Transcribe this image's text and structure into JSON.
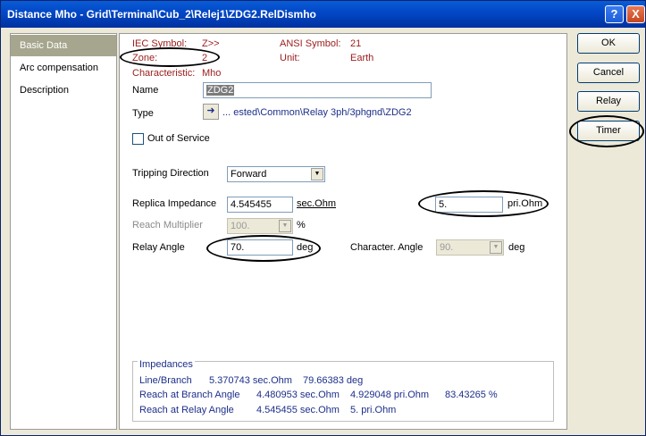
{
  "window": {
    "title": "Distance Mho - Grid\\Terminal\\Cub_2\\Relej1\\ZDG2.RelDismho",
    "help_btn": "?",
    "close_btn": "X"
  },
  "sidebar": {
    "items": [
      {
        "label": "Basic Data",
        "active": true
      },
      {
        "label": "Arc compensation",
        "active": false
      },
      {
        "label": "Description",
        "active": false
      }
    ]
  },
  "buttons": {
    "ok": "OK",
    "cancel": "Cancel",
    "relay": "Relay",
    "timer": "Timer"
  },
  "info": {
    "iec_symbol_label": "IEC Symbol:",
    "iec_symbol_value": "Z>>",
    "ansi_symbol_label": "ANSI Symbol:",
    "ansi_symbol_value": "21",
    "zone_label": "Zone:",
    "zone_value": "2",
    "unit_label": "Unit:",
    "unit_value": "Earth",
    "characteristic_label": "Characteristic:",
    "characteristic_value": "Mho"
  },
  "form": {
    "name_label": "Name",
    "name_value": "ZDG2",
    "type_label": "Type",
    "type_arrow": "➜",
    "type_value": "... ested\\Common\\Relay 3ph/3phgnd\\ZDG2",
    "out_of_service_label": "Out of Service",
    "out_of_service_checked": false,
    "tripping_direction_label": "Tripping Direction",
    "tripping_direction_value": "Forward",
    "replica_impedance_label": "Replica Impedance",
    "replica_impedance_value": "4.545455",
    "replica_impedance_unit": "sec.Ohm",
    "replica_impedance_pri_value": "5.",
    "replica_impedance_pri_unit": "pri.Ohm",
    "reach_multiplier_label": "Reach Multiplier",
    "reach_multiplier_value": "100.",
    "reach_multiplier_unit": "%",
    "relay_angle_label": "Relay Angle",
    "relay_angle_value": "70.",
    "relay_angle_unit": "deg",
    "character_angle_label": "Character. Angle",
    "character_angle_value": "90.",
    "character_angle_unit": "deg"
  },
  "impedances": {
    "title": "Impedances",
    "rows": [
      {
        "label": "Line/Branch",
        "v1": "5.370743 sec.Ohm",
        "v2": "79.66383 deg",
        "v3": ""
      },
      {
        "label": "Reach at Branch Angle",
        "v1": "4.480953 sec.Ohm",
        "v2": "4.929048 pri.Ohm",
        "v3": "83.43265 %"
      },
      {
        "label": "Reach at Relay Angle",
        "v1": "4.545455 sec.Ohm",
        "v2": "5. pri.Ohm",
        "v3": ""
      }
    ]
  },
  "icons": {
    "dropdown": "▼"
  },
  "colors": {
    "title_bar": "#0247c5",
    "info_red": "#9b1b1b",
    "info_blue": "#1c2f8a",
    "sidebar_active": "#a6a68e"
  }
}
